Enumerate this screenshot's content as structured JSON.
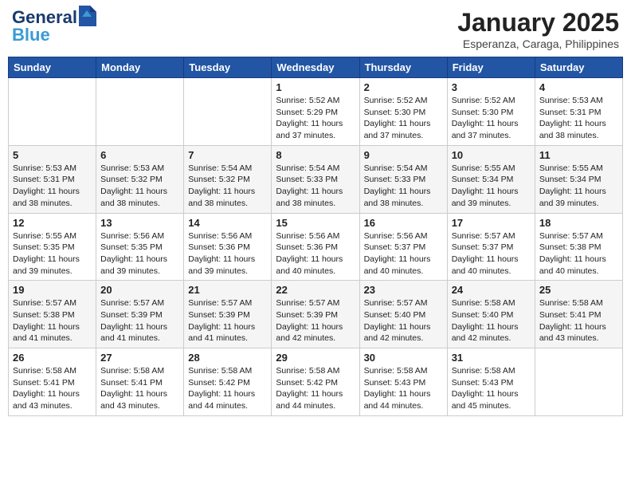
{
  "header": {
    "logo_line1": "General",
    "logo_line2": "Blue",
    "month_title": "January 2025",
    "location": "Esperanza, Caraga, Philippines"
  },
  "weekdays": [
    "Sunday",
    "Monday",
    "Tuesday",
    "Wednesday",
    "Thursday",
    "Friday",
    "Saturday"
  ],
  "weeks": [
    [
      {
        "day": "",
        "info": ""
      },
      {
        "day": "",
        "info": ""
      },
      {
        "day": "",
        "info": ""
      },
      {
        "day": "1",
        "info": "Sunrise: 5:52 AM\nSunset: 5:29 PM\nDaylight: 11 hours\nand 37 minutes."
      },
      {
        "day": "2",
        "info": "Sunrise: 5:52 AM\nSunset: 5:30 PM\nDaylight: 11 hours\nand 37 minutes."
      },
      {
        "day": "3",
        "info": "Sunrise: 5:52 AM\nSunset: 5:30 PM\nDaylight: 11 hours\nand 37 minutes."
      },
      {
        "day": "4",
        "info": "Sunrise: 5:53 AM\nSunset: 5:31 PM\nDaylight: 11 hours\nand 38 minutes."
      }
    ],
    [
      {
        "day": "5",
        "info": "Sunrise: 5:53 AM\nSunset: 5:31 PM\nDaylight: 11 hours\nand 38 minutes."
      },
      {
        "day": "6",
        "info": "Sunrise: 5:53 AM\nSunset: 5:32 PM\nDaylight: 11 hours\nand 38 minutes."
      },
      {
        "day": "7",
        "info": "Sunrise: 5:54 AM\nSunset: 5:32 PM\nDaylight: 11 hours\nand 38 minutes."
      },
      {
        "day": "8",
        "info": "Sunrise: 5:54 AM\nSunset: 5:33 PM\nDaylight: 11 hours\nand 38 minutes."
      },
      {
        "day": "9",
        "info": "Sunrise: 5:54 AM\nSunset: 5:33 PM\nDaylight: 11 hours\nand 38 minutes."
      },
      {
        "day": "10",
        "info": "Sunrise: 5:55 AM\nSunset: 5:34 PM\nDaylight: 11 hours\nand 39 minutes."
      },
      {
        "day": "11",
        "info": "Sunrise: 5:55 AM\nSunset: 5:34 PM\nDaylight: 11 hours\nand 39 minutes."
      }
    ],
    [
      {
        "day": "12",
        "info": "Sunrise: 5:55 AM\nSunset: 5:35 PM\nDaylight: 11 hours\nand 39 minutes."
      },
      {
        "day": "13",
        "info": "Sunrise: 5:56 AM\nSunset: 5:35 PM\nDaylight: 11 hours\nand 39 minutes."
      },
      {
        "day": "14",
        "info": "Sunrise: 5:56 AM\nSunset: 5:36 PM\nDaylight: 11 hours\nand 39 minutes."
      },
      {
        "day": "15",
        "info": "Sunrise: 5:56 AM\nSunset: 5:36 PM\nDaylight: 11 hours\nand 40 minutes."
      },
      {
        "day": "16",
        "info": "Sunrise: 5:56 AM\nSunset: 5:37 PM\nDaylight: 11 hours\nand 40 minutes."
      },
      {
        "day": "17",
        "info": "Sunrise: 5:57 AM\nSunset: 5:37 PM\nDaylight: 11 hours\nand 40 minutes."
      },
      {
        "day": "18",
        "info": "Sunrise: 5:57 AM\nSunset: 5:38 PM\nDaylight: 11 hours\nand 40 minutes."
      }
    ],
    [
      {
        "day": "19",
        "info": "Sunrise: 5:57 AM\nSunset: 5:38 PM\nDaylight: 11 hours\nand 41 minutes."
      },
      {
        "day": "20",
        "info": "Sunrise: 5:57 AM\nSunset: 5:39 PM\nDaylight: 11 hours\nand 41 minutes."
      },
      {
        "day": "21",
        "info": "Sunrise: 5:57 AM\nSunset: 5:39 PM\nDaylight: 11 hours\nand 41 minutes."
      },
      {
        "day": "22",
        "info": "Sunrise: 5:57 AM\nSunset: 5:39 PM\nDaylight: 11 hours\nand 42 minutes."
      },
      {
        "day": "23",
        "info": "Sunrise: 5:57 AM\nSunset: 5:40 PM\nDaylight: 11 hours\nand 42 minutes."
      },
      {
        "day": "24",
        "info": "Sunrise: 5:58 AM\nSunset: 5:40 PM\nDaylight: 11 hours\nand 42 minutes."
      },
      {
        "day": "25",
        "info": "Sunrise: 5:58 AM\nSunset: 5:41 PM\nDaylight: 11 hours\nand 43 minutes."
      }
    ],
    [
      {
        "day": "26",
        "info": "Sunrise: 5:58 AM\nSunset: 5:41 PM\nDaylight: 11 hours\nand 43 minutes."
      },
      {
        "day": "27",
        "info": "Sunrise: 5:58 AM\nSunset: 5:41 PM\nDaylight: 11 hours\nand 43 minutes."
      },
      {
        "day": "28",
        "info": "Sunrise: 5:58 AM\nSunset: 5:42 PM\nDaylight: 11 hours\nand 44 minutes."
      },
      {
        "day": "29",
        "info": "Sunrise: 5:58 AM\nSunset: 5:42 PM\nDaylight: 11 hours\nand 44 minutes."
      },
      {
        "day": "30",
        "info": "Sunrise: 5:58 AM\nSunset: 5:43 PM\nDaylight: 11 hours\nand 44 minutes."
      },
      {
        "day": "31",
        "info": "Sunrise: 5:58 AM\nSunset: 5:43 PM\nDaylight: 11 hours\nand 45 minutes."
      },
      {
        "day": "",
        "info": ""
      }
    ]
  ]
}
